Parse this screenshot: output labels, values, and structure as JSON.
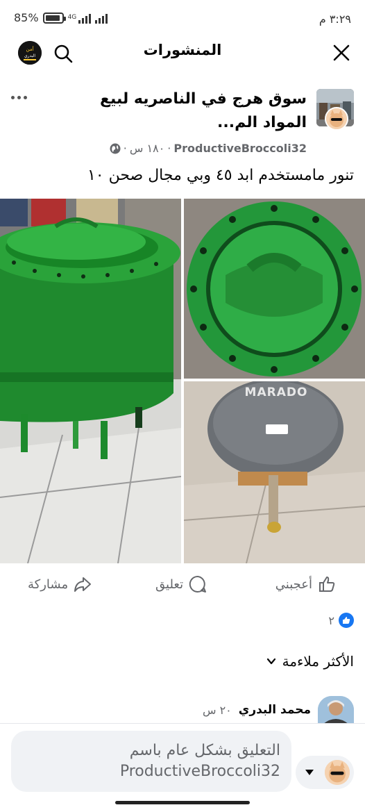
{
  "status_bar": {
    "time": "٣:٢٩ م",
    "battery": "85%",
    "network": "4G"
  },
  "header": {
    "title": "المنشورات",
    "avatar_text": "أمن البدري"
  },
  "post": {
    "group_name": "سوق هرج في الناصريه لبيع المواد الم...",
    "author": "ProductiveBroccoli32",
    "time": "١٨٠ س",
    "separator": "·",
    "text": "تنور مامستخدم ابد ٤٥ وبي مجال صحن ١٠",
    "photo_brand": "MARADO"
  },
  "actions": {
    "like": "أعجبني",
    "comment": "تعليق",
    "share": "مشاركة"
  },
  "reactions": {
    "count": "٢"
  },
  "sort": {
    "label": "الأكثر ملاءمة"
  },
  "comment": {
    "author": "محمد البدري",
    "time": "٢٠ س"
  },
  "composer": {
    "placeholder": "التعليق بشكل عام باسم ProductiveBroccoli32"
  },
  "colors": {
    "accent": "#1877f2",
    "text_secondary": "#65676b",
    "input_bg": "#f0f2f5"
  }
}
